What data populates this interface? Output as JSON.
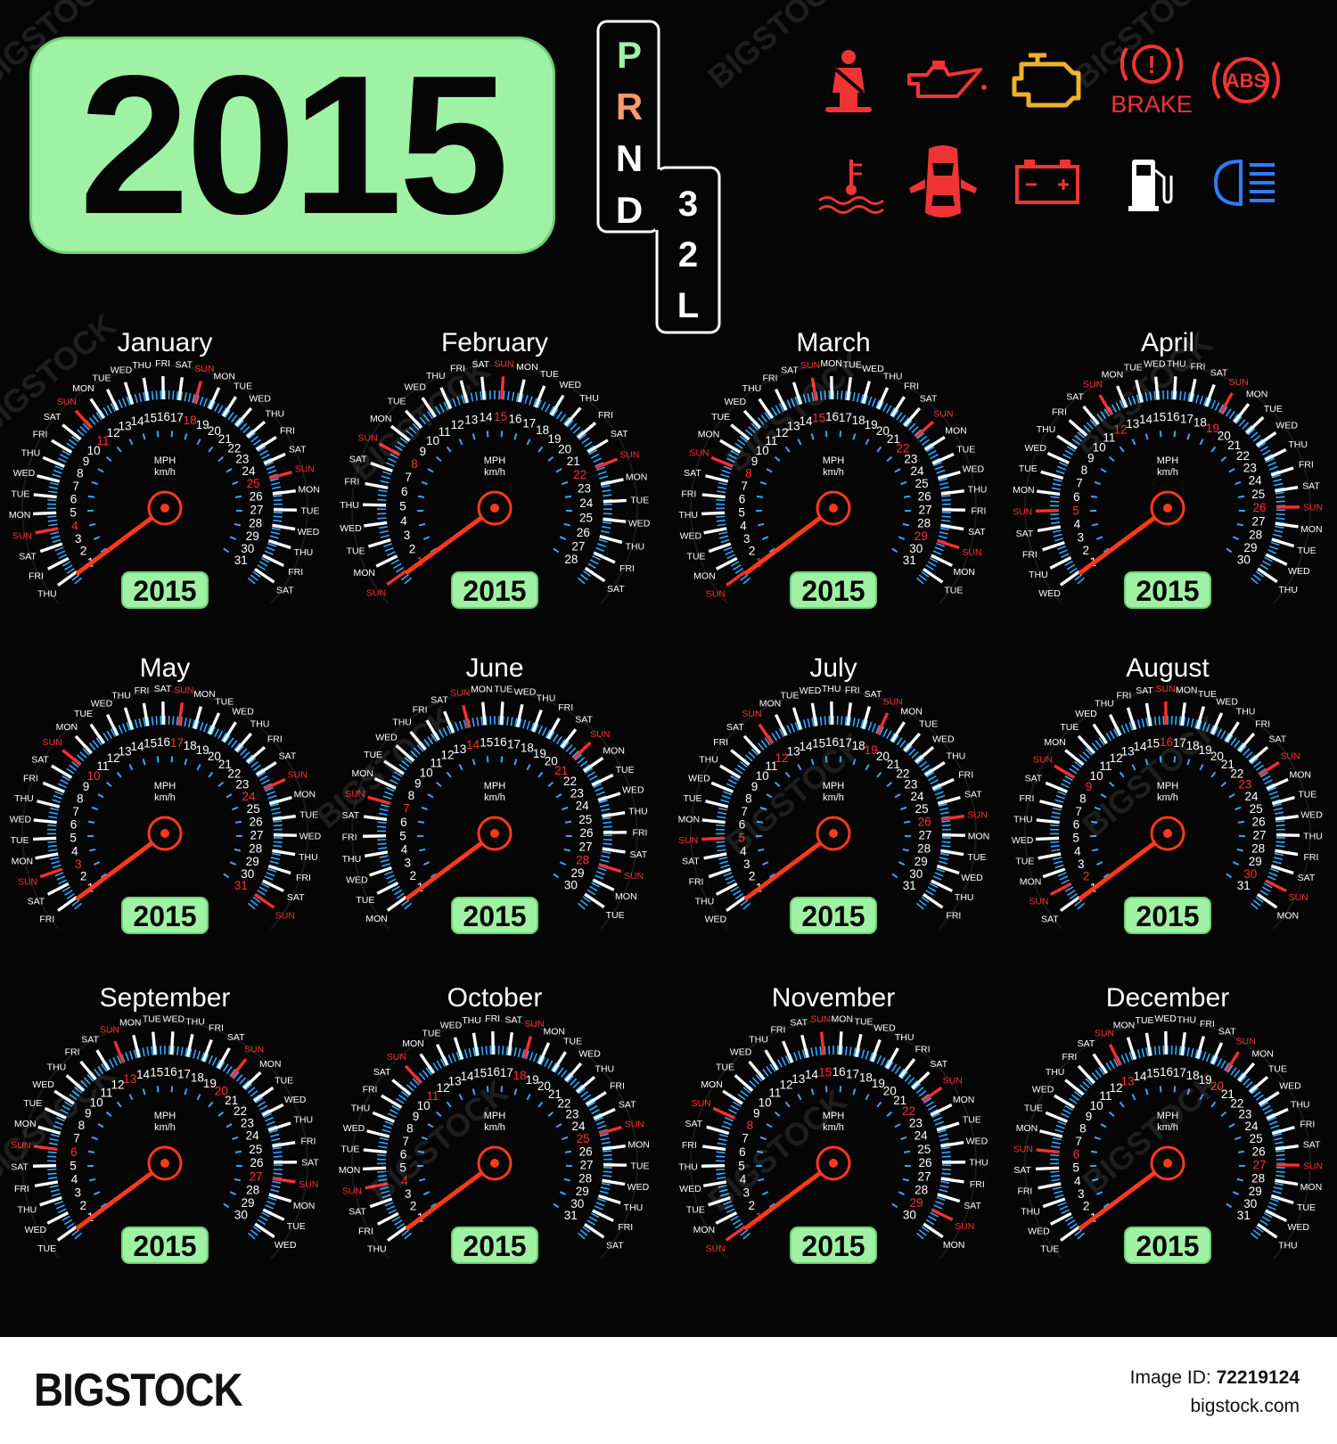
{
  "year": "2015",
  "gear_shifter": {
    "primary": [
      "P",
      "R",
      "N",
      "D"
    ],
    "secondary": [
      "3",
      "2",
      "L"
    ]
  },
  "warning_lights": {
    "icons": [
      "seatbelt-icon",
      "oil-can-icon",
      "check-engine-icon",
      "brake-warning-icon",
      "abs-warning-icon",
      "coolant-temperature-icon",
      "door-open-car-icon",
      "battery-icon",
      "fuel-pump-icon",
      "headlight-high-beam-icon"
    ],
    "brake_label": "BRAKE",
    "abs_label": "ABS"
  },
  "gauge_center_labels": [
    "MPH",
    "km/h"
  ],
  "weekdays": [
    "MON",
    "TUE",
    "WED",
    "THU",
    "FRI",
    "SAT",
    "SUN"
  ],
  "months": [
    {
      "name": "January",
      "days": 31,
      "start_weekday": "THU"
    },
    {
      "name": "February",
      "days": 28,
      "start_weekday": "SUN"
    },
    {
      "name": "March",
      "days": 31,
      "start_weekday": "SUN"
    },
    {
      "name": "April",
      "days": 30,
      "start_weekday": "WED"
    },
    {
      "name": "May",
      "days": 31,
      "start_weekday": "FRI"
    },
    {
      "name": "June",
      "days": 30,
      "start_weekday": "MON"
    },
    {
      "name": "July",
      "days": 31,
      "start_weekday": "WED"
    },
    {
      "name": "August",
      "days": 31,
      "start_weekday": "SAT"
    },
    {
      "name": "September",
      "days": 30,
      "start_weekday": "TUE"
    },
    {
      "name": "October",
      "days": 31,
      "start_weekday": "THU"
    },
    {
      "name": "November",
      "days": 30,
      "start_weekday": "SUN"
    },
    {
      "name": "December",
      "days": 31,
      "start_weekday": "TUE"
    }
  ],
  "watermark": "BIGSTOCK",
  "footer": {
    "brand": "BIGSTOCK",
    "image_id_label": "Image ID:",
    "image_id": "72219124",
    "site": "bigstock.com"
  },
  "colors": {
    "background": "#050505",
    "badge_green": "#9ff2a3",
    "sunday_red": "#ff2f2f",
    "needle_red": "#ff3a1a",
    "tick_white": "#ffffff",
    "tick_blue": "#31a9ff",
    "shifter_green": "#9ff2a3",
    "shifter_orange": "#ff9966",
    "engine_amber": "#f0b02c",
    "headlight_blue": "#2f7dff"
  }
}
